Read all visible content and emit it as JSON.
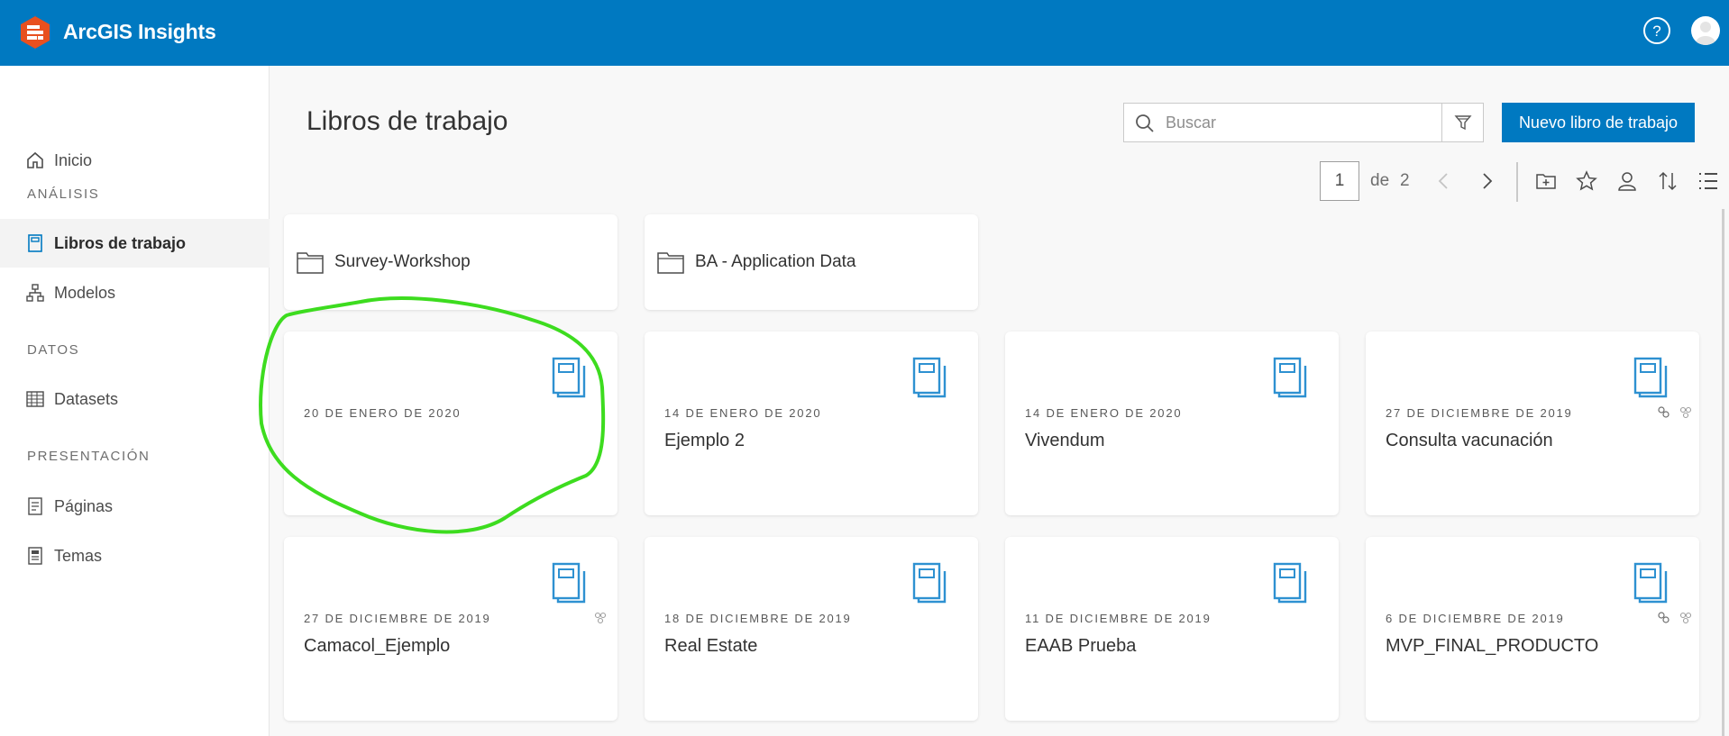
{
  "header": {
    "app_title": "ArcGIS Insights",
    "logo_icon": "arcgis-insights-logo-icon",
    "help_icon": "help-circle-icon",
    "avatar_icon": "user-avatar-icon",
    "brand_color": "#0079c1"
  },
  "sidebar": {
    "home": {
      "label": "Inicio",
      "icon": "home-icon"
    },
    "sections": {
      "analysis": "ANÁLISIS",
      "data": "DATOS",
      "presentation": "PRESENTACIÓN"
    },
    "items": {
      "workbooks": {
        "label": "Libros de trabajo",
        "icon": "workbook-icon",
        "active": true
      },
      "models": {
        "label": "Modelos",
        "icon": "model-icon"
      },
      "datasets": {
        "label": "Datasets",
        "icon": "table-icon"
      },
      "pages": {
        "label": "Páginas",
        "icon": "page-icon"
      },
      "themes": {
        "label": "Temas",
        "icon": "theme-icon"
      }
    }
  },
  "main": {
    "page_title": "Libros de trabajo",
    "search": {
      "placeholder": "Buscar",
      "value": ""
    },
    "new_button_label": "Nuevo libro de trabajo",
    "pager": {
      "current": "1",
      "of_label": "de",
      "total": "2"
    },
    "toolbar_icons": [
      "chevron-left-icon",
      "chevron-right-icon",
      "add-folder-icon",
      "star-icon",
      "user-icon",
      "sort-icon",
      "list-view-icon"
    ],
    "folders": [
      {
        "name": "Survey-Workshop"
      },
      {
        "name": "BA - Application Data"
      }
    ],
    "workbooks": [
      {
        "date": "20 DE ENERO DE 2020",
        "title": ""
      },
      {
        "date": "14 DE ENERO DE 2020",
        "title": "Ejemplo 2"
      },
      {
        "date": "14 DE ENERO DE 2020",
        "title": "Vivendum"
      },
      {
        "date": "27 DE DICIEMBRE DE 2019",
        "title": "Consulta vacunación"
      },
      {
        "date": "27 DE DICIEMBRE DE 2019",
        "title": "Camacol_Ejemplo"
      },
      {
        "date": "18 DE DICIEMBRE DE 2019",
        "title": "Real Estate"
      },
      {
        "date": "11 DE DICIEMBRE DE 2019",
        "title": "EAAB Prueba"
      },
      {
        "date": "6 DE DICIEMBRE DE 2019",
        "title": "MVP_FINAL_PRODUCTO"
      }
    ],
    "annotation_color": "#3ddc1f"
  }
}
